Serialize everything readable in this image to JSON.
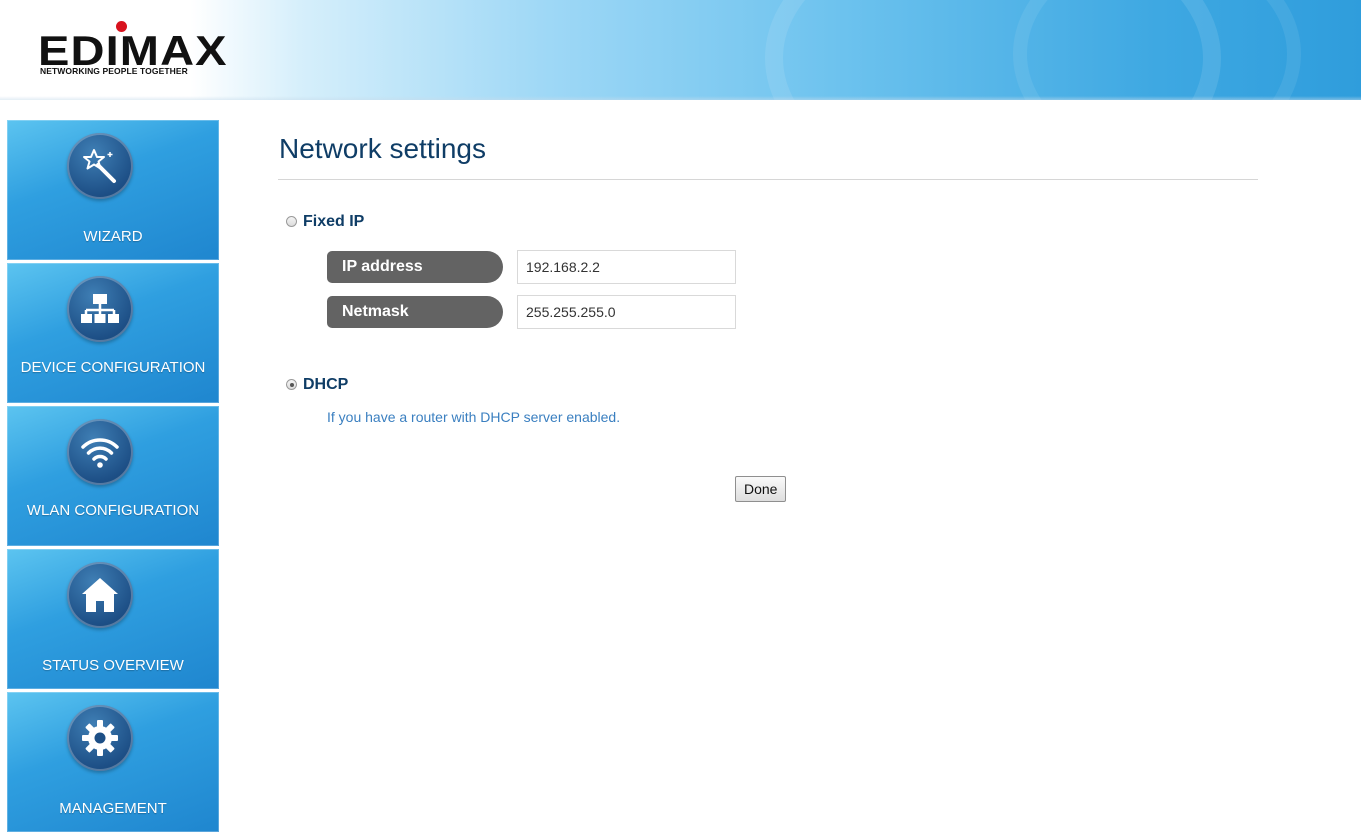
{
  "brand": {
    "name": "EDIMAX",
    "tagline": "NETWORKING PEOPLE TOGETHER"
  },
  "sidebar": {
    "items": [
      {
        "label": "WIZARD",
        "icon": "wizard-wand-icon"
      },
      {
        "label": "DEVICE CONFIGURATION",
        "icon": "network-tree-icon"
      },
      {
        "label": "WLAN CONFIGURATION",
        "icon": "wifi-icon"
      },
      {
        "label": "STATUS OVERVIEW",
        "icon": "home-icon"
      },
      {
        "label": "MANAGEMENT",
        "icon": "gear-icon"
      }
    ]
  },
  "main": {
    "title": "Network settings",
    "fixed_ip": {
      "label": "Fixed IP",
      "selected": false,
      "fields": [
        {
          "label": "IP address",
          "value": "192.168.2.2"
        },
        {
          "label": "Netmask",
          "value": "255.255.255.0"
        }
      ]
    },
    "dhcp": {
      "label": "DHCP",
      "selected": true,
      "hint": "If you have a router with DHCP server enabled."
    },
    "done_label": "Done"
  },
  "colors": {
    "title": "#0f3d66",
    "hint": "#3a7fc0",
    "field_label_bg": "#636363",
    "nav_bg": "#2f9fe0",
    "logo_dot": "#d8121e"
  }
}
